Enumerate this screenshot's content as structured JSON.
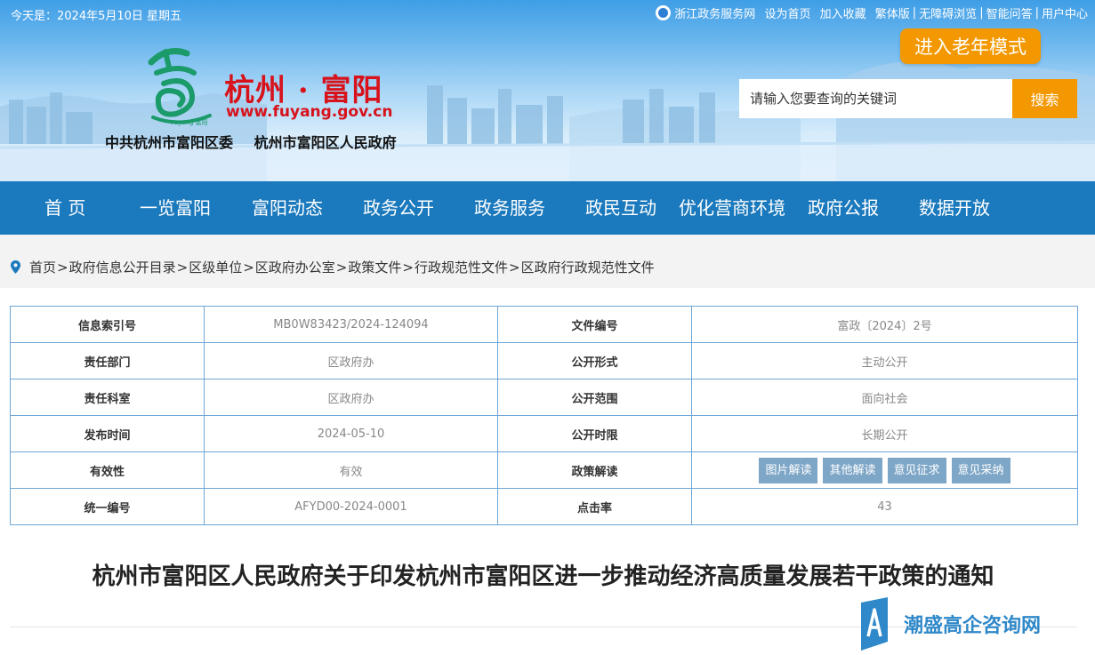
{
  "topbar": {
    "date": "今天是：2024年5月10日 星期五",
    "links": [
      "浙江政务服务网",
      "设为首页",
      "加入收藏",
      "繁体版",
      "无障碍浏览",
      "智能问答",
      "用户中心"
    ]
  },
  "header": {
    "site_name": "杭州 · 富阳",
    "site_url": "www.fuyang.gov.cn",
    "org_left": "中共杭州市富阳区委",
    "org_right": "杭州市富阳区人民政府",
    "elder_mode": "进入老年模式",
    "logo_text": "Fuyang 富阳"
  },
  "search": {
    "placeholder": "请输入您要查询的关键词",
    "button": "搜索"
  },
  "nav": [
    "首 页",
    "一览富阳",
    "富阳动态",
    "政务公开",
    "政务服务",
    "政民互动",
    "优化营商环境",
    "政府公报",
    "数据开放"
  ],
  "breadcrumb": [
    "首页",
    "政府信息公开目录",
    "区级单位",
    "区政府办公室",
    "政策文件",
    "行政规范性文件",
    "区政府行政规范性文件"
  ],
  "info": {
    "rows": [
      {
        "l1": "信息索引号",
        "v1": "MB0W83423/2024-124094",
        "l2": "文件编号",
        "v2": "富政〔2024〕2号"
      },
      {
        "l1": "责任部门",
        "v1": "区政府办",
        "l2": "公开形式",
        "v2": "主动公开"
      },
      {
        "l1": "责任科室",
        "v1": "区政府办",
        "l2": "公开范围",
        "v2": "面向社会"
      },
      {
        "l1": "发布时间",
        "v1": "2024-05-10",
        "l2": "公开时限",
        "v2": "长期公开"
      },
      {
        "l1": "有效性",
        "v1": "有效",
        "l2": "政策解读",
        "v2": ""
      },
      {
        "l1": "统一编号",
        "v1": "AFYD00-2024-0001",
        "l2": "点击率",
        "v2": "43"
      }
    ],
    "policy_tags": [
      "图片解读",
      "其他解读",
      "意见征求",
      "意见采纳"
    ]
  },
  "title": "杭州市富阳区人民政府关于印发杭州市富阳区进一步推动经济高质量发展若干政策的通知",
  "watermark": "潮盛高企咨询网",
  "colors": {
    "nav": "#1b79bd",
    "accent": "#f39800",
    "brand_red": "#d7121b",
    "table_border": "#6ea6d8",
    "tag": "#7ea6c7"
  }
}
